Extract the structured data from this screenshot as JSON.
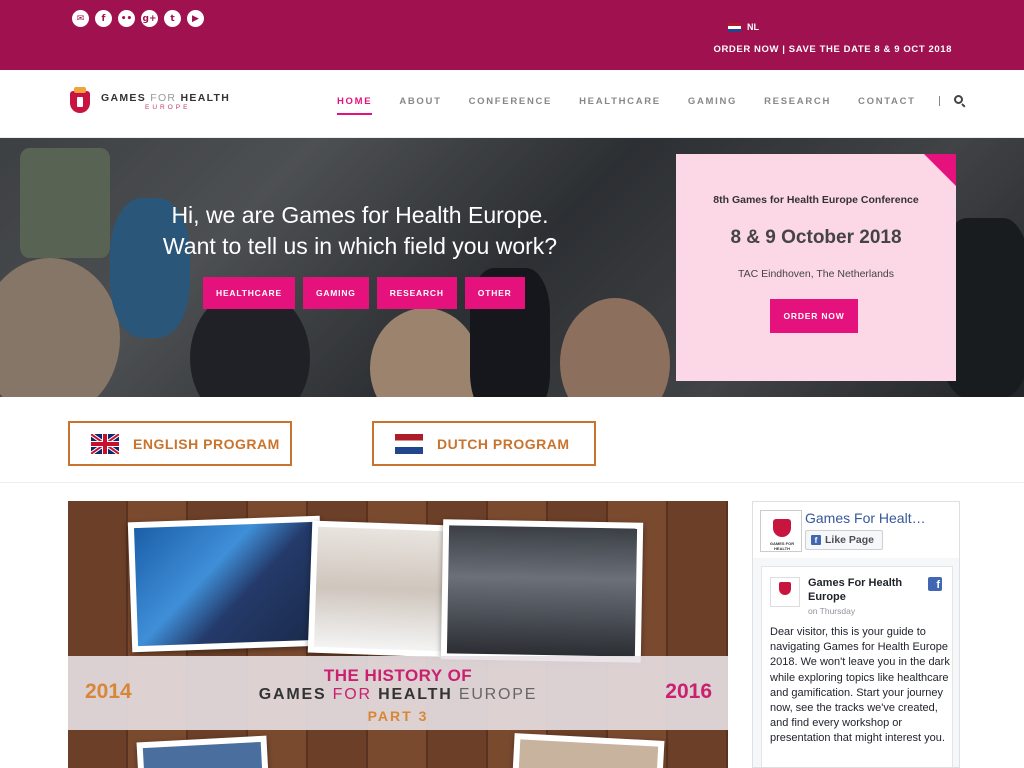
{
  "topbar": {
    "socials": [
      {
        "icon": "email-icon",
        "glyph": "✉"
      },
      {
        "icon": "facebook-icon",
        "glyph": "f"
      },
      {
        "icon": "flickr-icon",
        "glyph": "••"
      },
      {
        "icon": "google-plus-icon",
        "glyph": "g+"
      },
      {
        "icon": "twitter-icon",
        "glyph": "t"
      },
      {
        "icon": "youtube-icon",
        "glyph": "▶"
      }
    ],
    "lang_label": "NL",
    "cta_text": "ORDER NOW | SAVE THE DATE 8 & 9 OCT 2018"
  },
  "header": {
    "logo_main_a": "GAMES",
    "logo_main_for": "FOR",
    "logo_main_b": "HEALTH",
    "logo_sub": "EUROPE",
    "nav": [
      {
        "label": "HOME",
        "active": true
      },
      {
        "label": "ABOUT",
        "active": false
      },
      {
        "label": "CONFERENCE",
        "active": false
      },
      {
        "label": "HEALTHCARE",
        "active": false
      },
      {
        "label": "GAMING",
        "active": false
      },
      {
        "label": "RESEARCH",
        "active": false
      },
      {
        "label": "CONTACT",
        "active": false
      }
    ]
  },
  "hero": {
    "title_line1": "Hi, we are Games for Health Europe.",
    "title_line2": "Want to tell us in which field you work?",
    "buttons": [
      "HEALTHCARE",
      "GAMING",
      "RESEARCH",
      "OTHER"
    ],
    "event": {
      "label": "8th Games for Health Europe Conference",
      "date": "8 & 9 October 2018",
      "place": "TAC Eindhoven, The Netherlands",
      "button": "ORDER NOW"
    }
  },
  "programs": {
    "english": "ENGLISH PROGRAM",
    "dutch": "DUTCH PROGRAM"
  },
  "banner": {
    "year_left": "2014",
    "year_right": "2016",
    "top": "THE HISTORY OF",
    "main_a": "GAMES",
    "main_for": "FOR",
    "main_b": "HEALTH",
    "main_c": "EUROPE",
    "part": "PART 3"
  },
  "facebook": {
    "page_name": "Games For Healt…",
    "avatar_text": "GAMES FOR HEALTH",
    "like_label": "Like Page",
    "post_name": "Games For Health Europe",
    "post_time": "on Thursday",
    "post_text": "Dear visitor, this is your guide to navigating Games for Health Europe 2018. We won't leave you in the dark while exploring topics like healthcare and gamification. Start your journey now, see the tracks we've created, and find every workshop or presentation that might interest you."
  }
}
